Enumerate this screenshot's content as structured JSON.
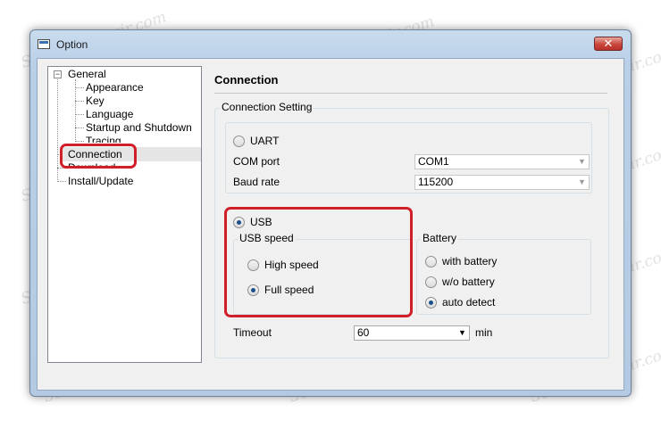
{
  "window": {
    "title": "Option",
    "close_label": "✕"
  },
  "tree": {
    "general": "General",
    "children": [
      "Appearance",
      "Key",
      "Language",
      "Startup and Shutdown",
      "Tracing"
    ],
    "connection": "Connection",
    "download": "Download",
    "install": "Install/Update",
    "collapse_glyph": "−"
  },
  "connection": {
    "title": "Connection",
    "setting_group": "Connection Setting",
    "uart_label": "UART",
    "com_port_label": "COM port",
    "com_port_value": "COM1",
    "baud_rate_label": "Baud rate",
    "baud_rate_value": "115200",
    "usb_label": "USB",
    "usb_speed_group": "USB speed",
    "high_speed_label": "High speed",
    "full_speed_label": "Full speed",
    "battery_group": "Battery",
    "with_battery_label": "with battery",
    "wo_battery_label": "w/o battery",
    "auto_detect_label": "auto detect",
    "timeout_label": "Timeout",
    "timeout_value": "60",
    "timeout_unit": "min",
    "arrow_glyph": "▼"
  },
  "watermark": "Soringpcrepair.com",
  "colors": {
    "highlight_red": "#d11f2a",
    "selection_gray": "#e5e5e5",
    "radio_dot": "#1b4f8c"
  }
}
